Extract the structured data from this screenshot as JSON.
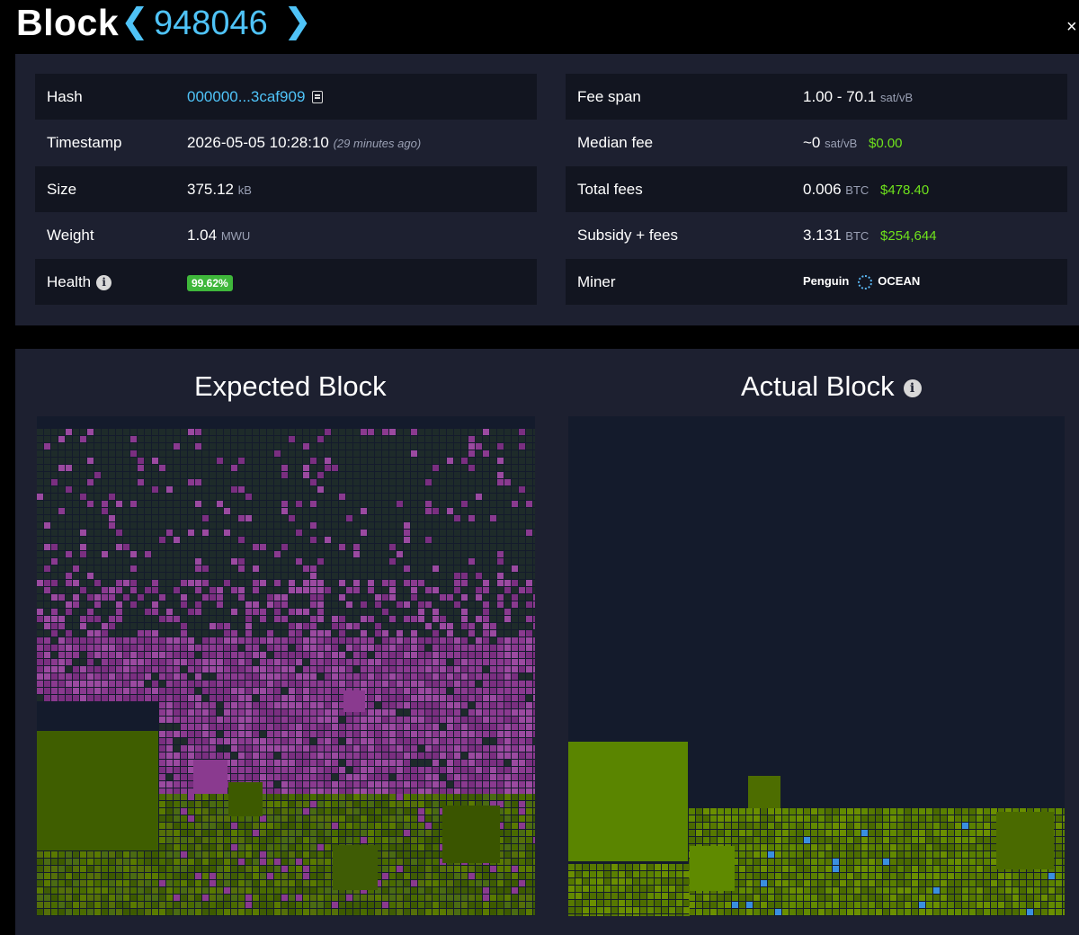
{
  "header": {
    "title": "Block",
    "height": "948046",
    "prev_glyph": "❮",
    "next_glyph": "❯",
    "close_glyph": "×"
  },
  "details": {
    "left": [
      {
        "label": "Hash",
        "value": "000000...3caf909"
      },
      {
        "label": "Timestamp",
        "value": "2026-05-05 10:28:10",
        "note": "(29 minutes ago)"
      },
      {
        "label": "Size",
        "value": "375.12",
        "unit": "kB"
      },
      {
        "label": "Weight",
        "value": "1.04",
        "unit": "MWU"
      },
      {
        "label": "Health",
        "value": "99.62%"
      }
    ],
    "right": [
      {
        "label": "Fee span",
        "value": "1.00 - 70.1",
        "unit": "sat/vB"
      },
      {
        "label": "Median fee",
        "value": "~0",
        "unit": "sat/vB",
        "fiat": "$0.00"
      },
      {
        "label": "Total fees",
        "value": "0.006",
        "unit": "BTC",
        "fiat": "$478.40"
      },
      {
        "label": "Subsidy + fees",
        "value": "3.131",
        "unit": "BTC",
        "fiat": "$254,644"
      },
      {
        "label": "Miner",
        "value": "Penguin",
        "pool": "OCEAN"
      }
    ]
  },
  "comparison": {
    "expected_title": "Expected Block",
    "actual_title": "Actual Block"
  },
  "colors": {
    "accent": "#4fc3f7",
    "fiat": "#6fe31c",
    "health_badge": "#3fb73b",
    "card_bg": "#1d2030",
    "viz_bg": "#141b2c",
    "added_tx": "#8a3a8f",
    "fee_green": "#4a6b00"
  },
  "icons": [
    "chevron-left-icon",
    "chevron-right-icon",
    "close-icon",
    "copy-icon",
    "info-icon",
    "ocean-pool-icon"
  ]
}
